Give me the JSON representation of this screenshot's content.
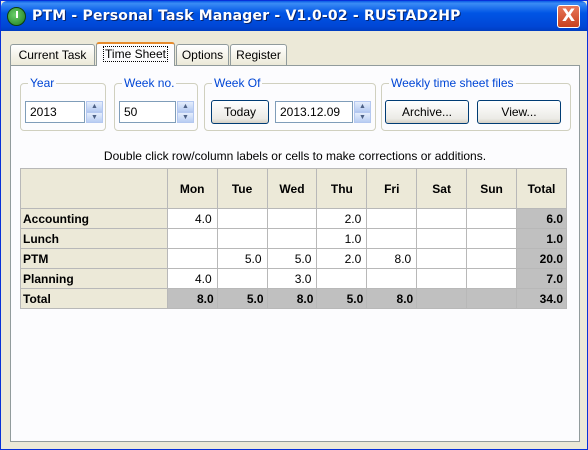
{
  "window": {
    "title": "PTM - Personal Task Manager - V1.0-02 - RUSTAD2HP",
    "close_label": "X"
  },
  "tabs": [
    {
      "label": "Current Task"
    },
    {
      "label": "Time Sheet"
    },
    {
      "label": "Options"
    },
    {
      "label": "Register"
    }
  ],
  "active_tab": "Time Sheet",
  "year": {
    "title": "Year",
    "value": "2013"
  },
  "week_no": {
    "title": "Week no.",
    "value": "50"
  },
  "week_of": {
    "title": "Week Of",
    "today_label": "Today",
    "value": "2013.12.09"
  },
  "files": {
    "title": "Weekly time sheet files",
    "archive_label": "Archive...",
    "view_label": "View..."
  },
  "hint": "Double click row/column labels or cells to make corrections or additions.",
  "timesheet": {
    "columns": [
      "Mon",
      "Tue",
      "Wed",
      "Thu",
      "Fri",
      "Sat",
      "Sun",
      "Total"
    ],
    "rows": [
      {
        "label": "Accounting",
        "cells": [
          "4.0",
          "",
          "",
          "2.0",
          "",
          "",
          ""
        ],
        "total": "6.0"
      },
      {
        "label": "Lunch",
        "cells": [
          "",
          "",
          "",
          "1.0",
          "",
          "",
          ""
        ],
        "total": "1.0"
      },
      {
        "label": "PTM",
        "cells": [
          "",
          "5.0",
          "5.0",
          "2.0",
          "8.0",
          "",
          ""
        ],
        "total": "20.0"
      },
      {
        "label": "Planning",
        "cells": [
          "4.0",
          "",
          "3.0",
          "",
          "",
          "",
          ""
        ],
        "total": "7.0"
      }
    ],
    "totals": {
      "label": "Total",
      "cells": [
        "8.0",
        "5.0",
        "8.0",
        "5.0",
        "8.0",
        "",
        ""
      ],
      "total": "34.0"
    }
  },
  "colors": {
    "title_bar": "#0055e5",
    "accent": "#0046d5",
    "total_cell": "#c0c0c0"
  },
  "icons": {
    "app": "ptm-app-icon",
    "close": "close-icon",
    "spin": "spinner-arrows-icon"
  }
}
